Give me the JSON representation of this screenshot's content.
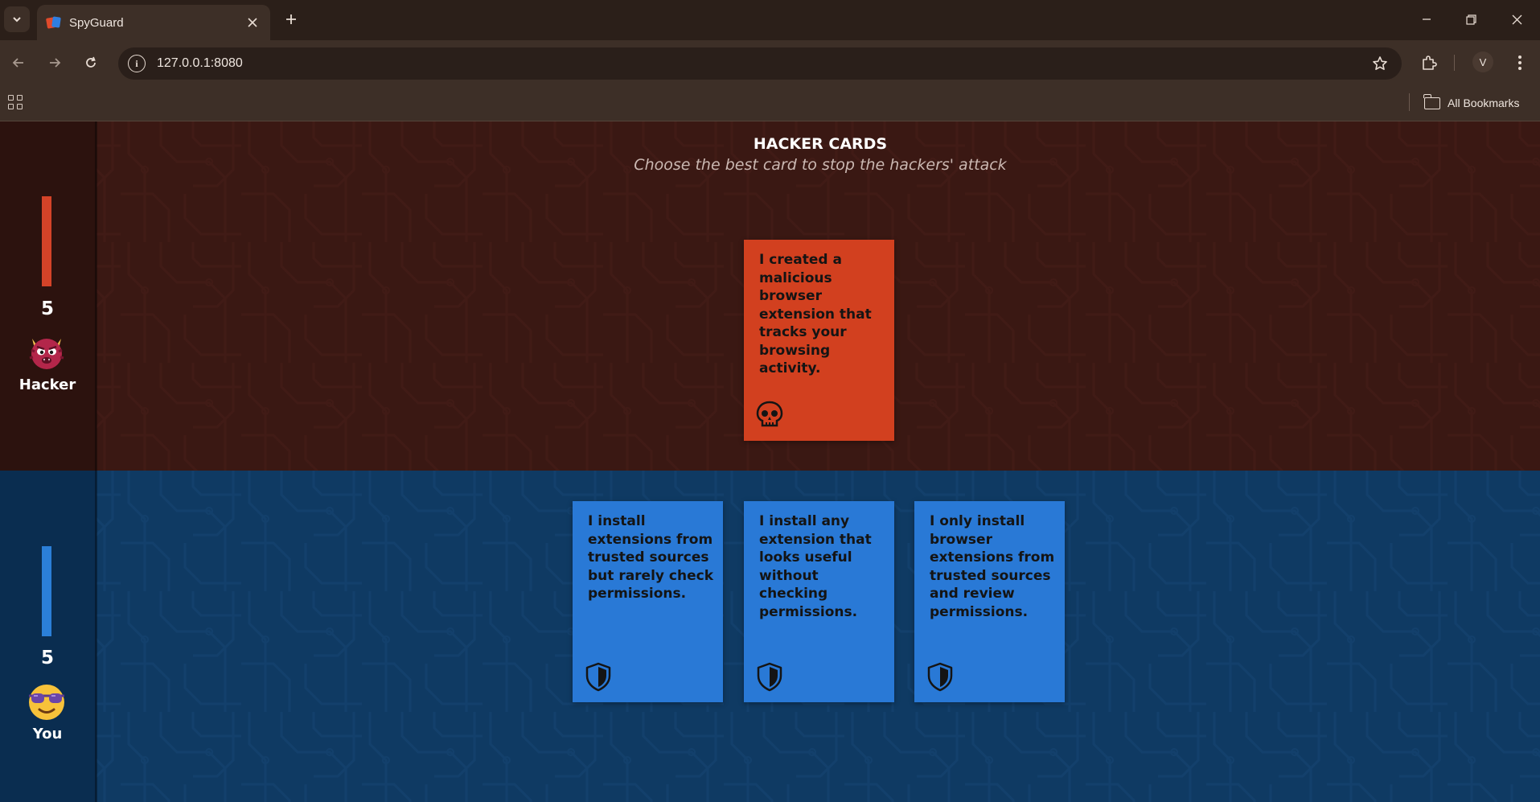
{
  "browser": {
    "tab_title": "SpyGuard",
    "url": "127.0.0.1:8080",
    "bookmarks_label": "All Bookmarks",
    "profile_initial": "V"
  },
  "game": {
    "title": "HACKER CARDS",
    "subtitle": "Choose the best card to stop the hackers' attack",
    "hacker": {
      "label": "Hacker",
      "score": "5",
      "bar_color": "#d44328",
      "avatar_icon": "devil-face-icon"
    },
    "player": {
      "label": "You",
      "score": "5",
      "bar_color": "#2b7fd8",
      "avatar_icon": "sunglasses-face-icon"
    },
    "hacker_card": {
      "text": "I created a malicious browser extension that tracks your browsing activity.",
      "icon": "skull-icon",
      "color": "#d2401f"
    },
    "defense_cards": [
      {
        "text": "I install extensions from trusted sources but rarely check permissions.",
        "icon": "shield-icon"
      },
      {
        "text": "I install any extension that looks useful without checking permissions.",
        "icon": "shield-icon"
      },
      {
        "text": "I only install browser extensions from trusted sources and review permissions.",
        "icon": "shield-icon"
      }
    ],
    "defense_color": "#2979d6"
  }
}
